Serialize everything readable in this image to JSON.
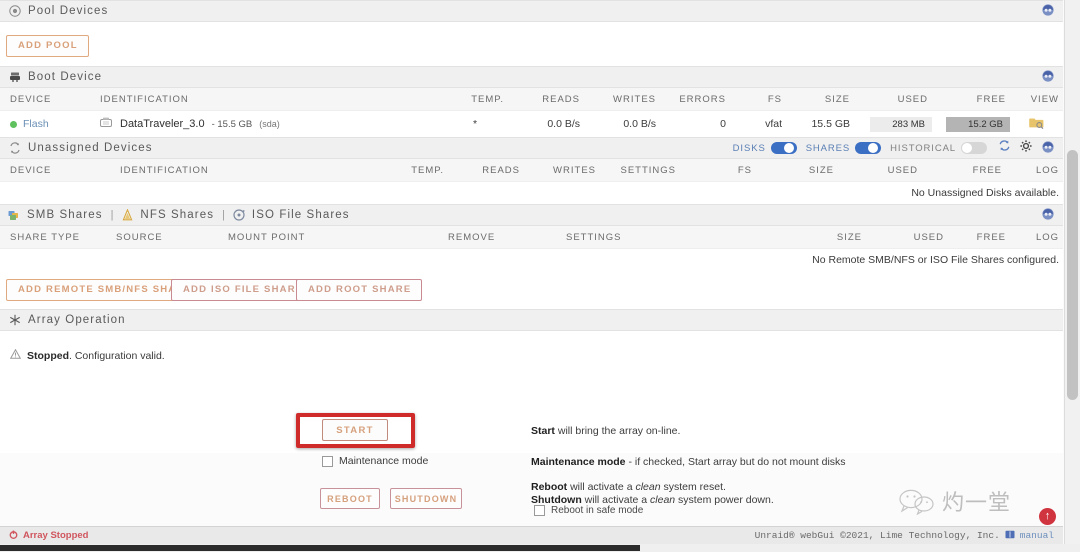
{
  "sections": {
    "pool_devices": {
      "title": "Pool Devices",
      "icon": "pool-icon",
      "add_pool_label": "ADD POOL"
    },
    "boot_device": {
      "title": "Boot Device",
      "columns": [
        "DEVICE",
        "IDENTIFICATION",
        "TEMP.",
        "READS",
        "WRITES",
        "ERRORS",
        "FS",
        "SIZE",
        "USED",
        "FREE",
        "VIEW"
      ],
      "row": {
        "device": "Flash",
        "status_color": "#5ec15e",
        "identification_name": "DataTraveler_3.0",
        "identification_size": "- 15.5 GB",
        "identification_dev": "(sda)",
        "temp": "*",
        "reads": "0.0 B/s",
        "writes": "0.0 B/s",
        "errors": "0",
        "fs": "vfat",
        "size": "15.5 GB",
        "used": "283 MB",
        "free": "15.2 GB",
        "view_icon": "folder-search-icon"
      }
    },
    "unassigned_devices": {
      "title": "Unassigned Devices",
      "columns": [
        "DEVICE",
        "IDENTIFICATION",
        "TEMP.",
        "READS",
        "WRITES",
        "SETTINGS",
        "FS",
        "SIZE",
        "USED",
        "FREE",
        "LOG"
      ],
      "empty_text": "No Unassigned Disks available.",
      "toggles": [
        {
          "label": "DISKS",
          "state": "on"
        },
        {
          "label": "SHARES",
          "state": "on"
        },
        {
          "label": "HISTORICAL",
          "state": "off"
        }
      ],
      "icons": [
        "refresh-icon",
        "gear-icon",
        "help-icon"
      ]
    },
    "shares": {
      "tabs": [
        {
          "label": "SMB Shares",
          "icon": "smb-icon"
        },
        {
          "label": "NFS Shares",
          "icon": "nfs-icon"
        },
        {
          "label": "ISO File Shares",
          "icon": "iso-icon"
        }
      ],
      "separator": "|",
      "columns": [
        "SHARE TYPE",
        "SOURCE",
        "MOUNT POINT",
        "REMOVE",
        "SETTINGS",
        "SIZE",
        "USED",
        "FREE",
        "LOG"
      ],
      "empty_text": "No Remote SMB/NFS or ISO File Shares configured.",
      "buttons": [
        {
          "label": "ADD REMOTE SMB/NFS SHARE",
          "style": "orange"
        },
        {
          "label": "ADD ISO FILE SHARE",
          "style": "pink"
        },
        {
          "label": "ADD ROOT SHARE",
          "style": "pink"
        }
      ]
    },
    "array_operation": {
      "title": "Array Operation",
      "icon": "array-icon",
      "status_bold": "Stopped",
      "status_rest": ". Configuration valid.",
      "start_button": "START",
      "maintenance_label": "Maintenance mode",
      "maintenance_checked": false,
      "reboot_button": "REBOOT",
      "shutdown_button": "SHUTDOWN",
      "safe_mode_label": "Reboot in safe mode",
      "safe_mode_checked": false,
      "desc_start_bold": "Start",
      "desc_start_rest": " will bring the array on-line.",
      "desc_maint_bold": "Maintenance mode",
      "desc_maint_rest": " - if checked, Start array but do not mount disks",
      "desc_reboot_bold": "Reboot",
      "desc_reboot_mid": " will activate a ",
      "desc_reboot_em": "clean",
      "desc_reboot_end": " system reset.",
      "desc_shutdown_bold": "Shutdown",
      "desc_shutdown_mid": " will activate a ",
      "desc_shutdown_em": "clean",
      "desc_shutdown_end": " system power down."
    }
  },
  "footer": {
    "status": "Array Stopped",
    "status_color": "#d0555e",
    "copyright": "Unraid® webGui ©2021, Lime Technology, Inc.",
    "manual_link": "manual"
  },
  "watermark": {
    "text": "灼一堂",
    "icon": "wechat-icon"
  },
  "scroll_top_button": {
    "icon": "arrow-up-icon"
  }
}
